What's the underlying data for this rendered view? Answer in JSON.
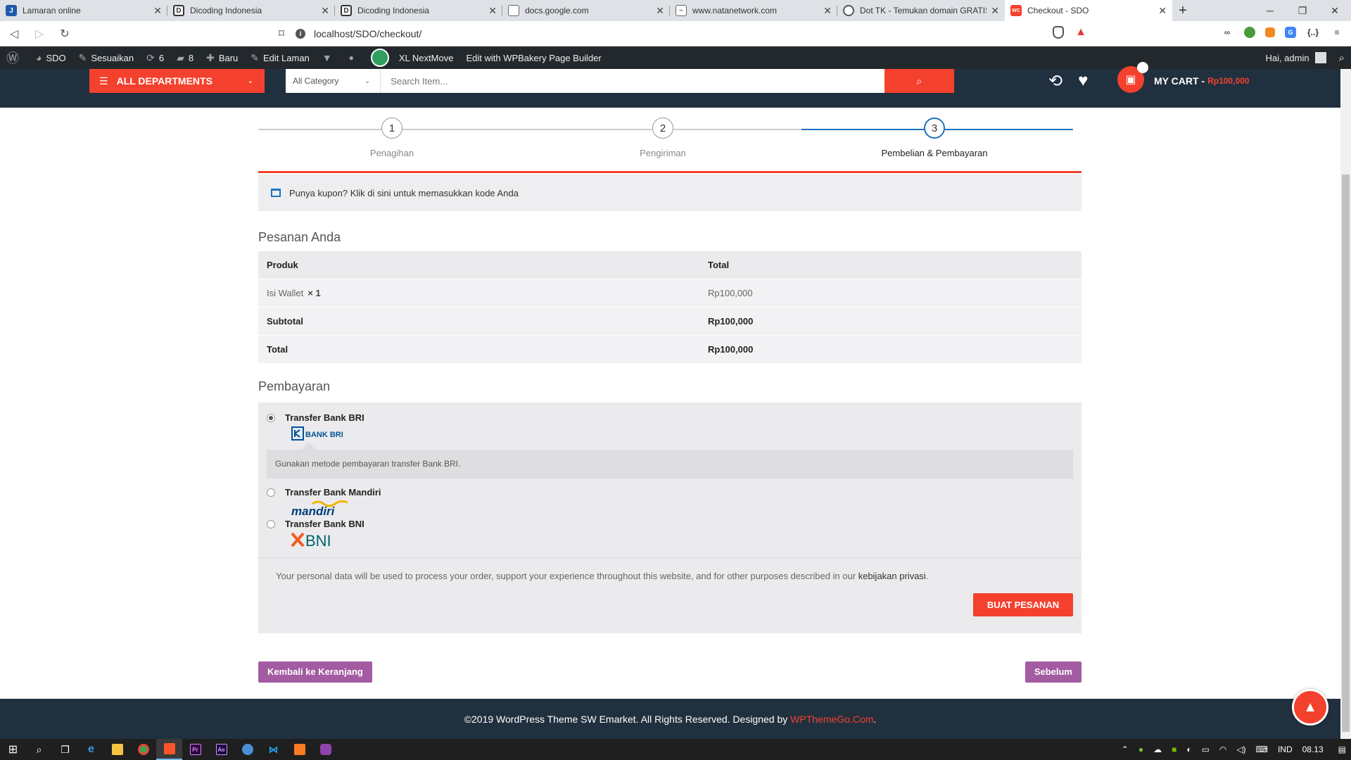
{
  "browser": {
    "tabs": [
      {
        "title": "Lamaran online",
        "favicon": "J",
        "color": "#1e5aa8"
      },
      {
        "title": "Dicoding Indonesia",
        "favicon": "D",
        "color": "#333"
      },
      {
        "title": "Dicoding Indonesia",
        "favicon": "D",
        "color": "#333"
      },
      {
        "title": "docs.google.com",
        "favicon": "doc",
        "color": "#777"
      },
      {
        "title": "www.natanetwork.com",
        "favicon": "N",
        "color": "#777"
      },
      {
        "title": "Dot TK - Temukan domain GRATIS",
        "favicon": "tk",
        "color": "#555"
      },
      {
        "title": "Checkout - SDO",
        "favicon": "WC",
        "color": "#f4412d"
      }
    ],
    "url": "localhost/SDO/checkout/"
  },
  "wpbar": {
    "site": "SDO",
    "customize": "Sesuaikan",
    "updates": "6",
    "comments": "8",
    "new": "Baru",
    "edit_page": "Edit Laman",
    "xl": "XL NextMove",
    "wpbakery": "Edit with WPBakery Page Builder",
    "greeting": "Hai, admin"
  },
  "header": {
    "departments": "ALL DEPARTMENTS",
    "category": "All Category",
    "search_placeholder": "Search Item...",
    "cart_label": "MY CART -",
    "cart_amount": "Rp100,000"
  },
  "steps": [
    {
      "num": "1",
      "label": "Penagihan"
    },
    {
      "num": "2",
      "label": "Pengiriman"
    },
    {
      "num": "3",
      "label": "Pembelian & Pembayaran"
    }
  ],
  "coupon": "Punya kupon? Klik di sini untuk memasukkan kode Anda",
  "order": {
    "title": "Pesanan Anda",
    "col_product": "Produk",
    "col_total": "Total",
    "item_name": "Isi Wallet",
    "item_qty": "× 1",
    "item_total": "Rp100,000",
    "subtotal_label": "Subtotal",
    "subtotal": "Rp100,000",
    "total_label": "Total",
    "total": "Rp100,000"
  },
  "payment": {
    "title": "Pembayaran",
    "methods": [
      {
        "name": "Transfer Bank BRI",
        "logo": "BANK BRI",
        "selected": true
      },
      {
        "name": "Transfer Bank Mandiri",
        "logo": "mandiri",
        "selected": false
      },
      {
        "name": "Transfer Bank BNI",
        "logo": "BNI",
        "selected": false
      }
    ],
    "bri_desc": "Gunakan metode pembayaran transfer Bank BRI.",
    "privacy_text": "Your personal data will be used to process your order, support your experience throughout this website, and for other purposes described in our",
    "privacy_link": "kebijakan privasi",
    "place_order": "BUAT PESANAN"
  },
  "nav": {
    "back_to_cart": "Kembali ke Keranjang",
    "previous": "Sebelum"
  },
  "footer": {
    "text": "©2019 WordPress Theme SW Emarket. All Rights Reserved. Designed by",
    "credit": "WPThemeGo.Com",
    "dot": "."
  },
  "taskbar": {
    "lang": "IND",
    "time": "08.13"
  },
  "colors": {
    "accent": "#f4412d",
    "dark": "#21303f",
    "step_active": "#1e73be",
    "purple": "#a35ba1"
  }
}
